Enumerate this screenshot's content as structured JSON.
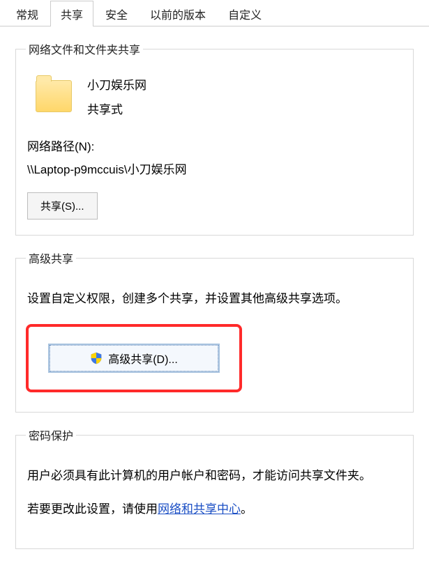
{
  "tabs": [
    "常规",
    "共享",
    "安全",
    "以前的版本",
    "自定义"
  ],
  "active_tab_index": 1,
  "section_network": {
    "title": "网络文件和文件夹共享",
    "folder_name": "小刀娱乐网",
    "status": "共享式",
    "path_label": "网络路径(N):",
    "path_value": "\\\\Laptop-p9mccuis\\小刀娱乐网",
    "share_button": "共享(S)..."
  },
  "section_advanced": {
    "title": "高级共享",
    "description": "设置自定义权限，创建多个共享，并设置其他高级共享选项。",
    "button": "高级共享(D)..."
  },
  "section_password": {
    "title": "密码保护",
    "line1": "用户必须具有此计算机的用户帐户和密码，才能访问共享文件夹。",
    "line2_prefix": "若要更改此设置，请使用",
    "line2_link": "网络和共享中心",
    "line2_suffix": "。"
  }
}
